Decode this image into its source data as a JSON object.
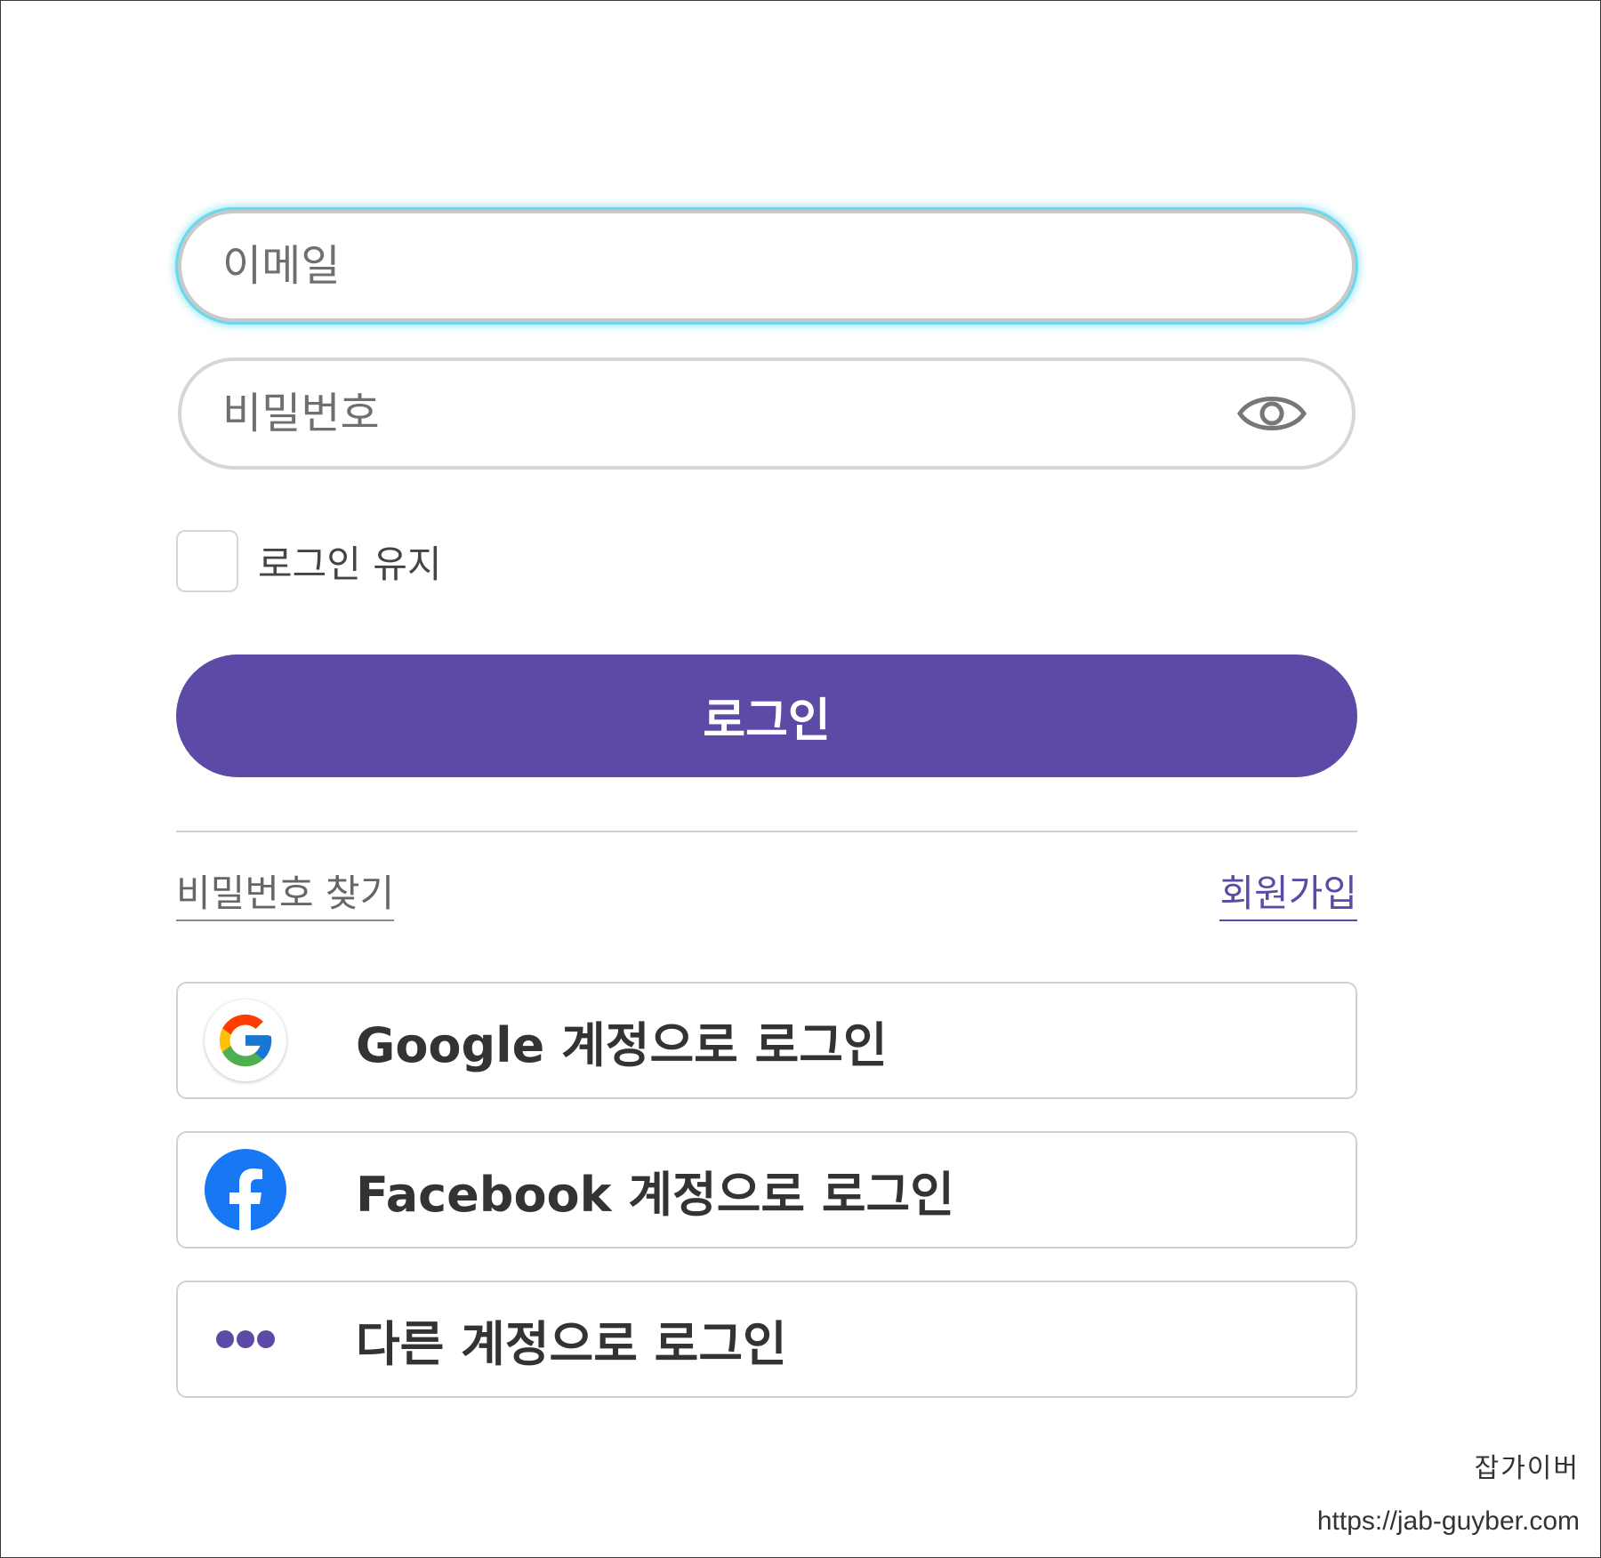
{
  "login_form": {
    "email": {
      "value": "",
      "placeholder": "이메일"
    },
    "password": {
      "value": "",
      "placeholder": "비밀번호",
      "toggle_icon": "eye-icon"
    },
    "remember_label": "로그인 유지",
    "remember_checked": false,
    "login_button_label": "로그인",
    "find_password_label": "비밀번호 찾기",
    "signup_label": "회원가입",
    "social": [
      {
        "icon": "google-icon",
        "label": "Google 계정으로 로그인"
      },
      {
        "icon": "facebook-icon",
        "label": "Facebook 계정으로 로그인"
      },
      {
        "icon": "more-dots-icon",
        "label": "다른 계정으로 로그인"
      }
    ]
  },
  "watermark": {
    "name": "잡가이버",
    "url": "https://jab-guyber.com"
  },
  "colors": {
    "primary": "#5c4aa6",
    "focus_ring": "#6ad8ee",
    "facebook_blue": "#1877f2"
  }
}
